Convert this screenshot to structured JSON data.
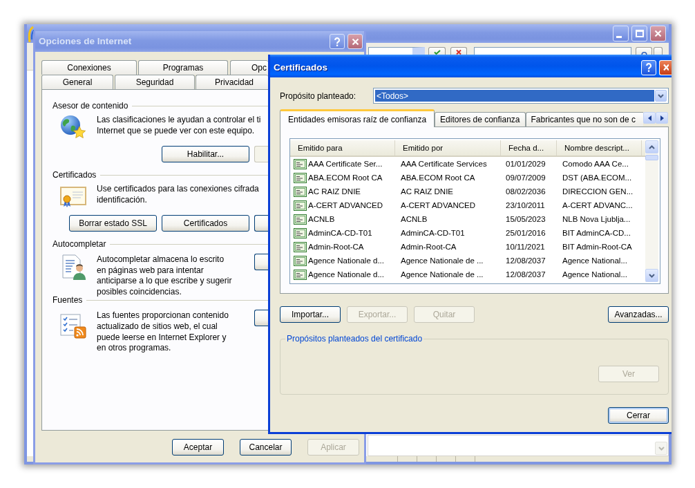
{
  "browser_window": {
    "active": false
  },
  "internet_options": {
    "title": "Opciones de Internet",
    "active": false,
    "tab_rows": [
      {
        "tabs": [
          {
            "label": "Conexiones",
            "selected": false
          },
          {
            "label": "Programas",
            "selected": false
          },
          {
            "label": "Opc",
            "selected": false
          }
        ]
      },
      {
        "tabs": [
          {
            "label": "General",
            "selected": false
          },
          {
            "label": "Seguridad",
            "selected": false
          },
          {
            "label": "Privacidad",
            "selected": false
          }
        ]
      }
    ],
    "groups": [
      {
        "kind": "ratings",
        "heading": "Asesor de contenido",
        "text": "Las clasificaciones le ayudan a controlar el ti\nInternet que se puede ver con este equipo.",
        "buttons": [
          {
            "label": "Habilitar...",
            "disabled": false
          },
          {
            "disabled": true
          }
        ]
      },
      {
        "kind": "certificates",
        "heading": "Certificados",
        "text": "Use certificados para las conexiones cifrada\nidentificación.",
        "buttons": [
          {
            "label": "Borrar estado SSL",
            "disabled": false
          },
          {
            "label": "Certificados",
            "disabled": false
          },
          {
            "disabled": false
          }
        ]
      },
      {
        "kind": "autocomplete",
        "heading": "Autocompletar",
        "text": "Autocompletar almacena lo escrito\nen páginas web para intentar\nanticiparse a lo que escribe y sugerir\nposibles coincidencias.",
        "buttons": [
          {
            "disabled": false
          }
        ]
      },
      {
        "kind": "feeds",
        "heading": "Fuentes",
        "text": "Las fuentes proporcionan contenido\nactualizado de sitios web, el cual\npuede leerse en Internet Explorer y\nen otros programas.",
        "buttons": [
          {
            "disabled": false
          }
        ]
      }
    ],
    "buttons": [
      {
        "label": "Aceptar",
        "disabled": false
      },
      {
        "label": "Cancelar",
        "disabled": false
      },
      {
        "label": "Aplicar",
        "disabled": true
      }
    ]
  },
  "certificates_dialog": {
    "title": "Certificados",
    "active": true,
    "purpose": {
      "label": "Propósito planteado:",
      "value": "<Todos>",
      "focused": true
    },
    "tabs": [
      {
        "label": "Entidades emisoras raíz de confianza",
        "selected": true
      },
      {
        "label": "Editores de confianza",
        "selected": false
      },
      {
        "label": "Fabricantes que no son de c",
        "selected": false
      }
    ],
    "table": {
      "columns": [
        "Emitido para",
        "Emitido por",
        "Fecha d...",
        "Nombre descript..."
      ],
      "rows": [
        [
          "AAA Certificate Ser...",
          "AAA Certificate Services",
          "01/01/2029",
          "Comodo AAA Ce..."
        ],
        [
          "ABA.ECOM Root CA",
          "ABA.ECOM Root CA",
          "09/07/2009",
          "DST (ABA.ECOM..."
        ],
        [
          "AC RAIZ DNIE",
          "AC RAIZ DNIE",
          "08/02/2036",
          "DIRECCION GEN..."
        ],
        [
          "A-CERT ADVANCED",
          "A-CERT ADVANCED",
          "23/10/2011",
          "A-CERT ADVANC..."
        ],
        [
          "ACNLB",
          "ACNLB",
          "15/05/2023",
          "NLB Nova Ljublja..."
        ],
        [
          "AdminCA-CD-T01",
          "AdminCA-CD-T01",
          "25/01/2016",
          "BIT AdminCA-CD..."
        ],
        [
          "Admin-Root-CA",
          "Admin-Root-CA",
          "10/11/2021",
          "BIT Admin-Root-CA"
        ],
        [
          "Agence Nationale d...",
          "Agence Nationale de ...",
          "12/08/2037",
          "Agence National..."
        ],
        [
          "Agence Nationale d...",
          "Agence Nationale de ...",
          "12/08/2037",
          "Agence National..."
        ]
      ]
    },
    "buttons": [
      {
        "label": "Importar...",
        "disabled": false
      },
      {
        "label": "Exportar...",
        "disabled": true
      },
      {
        "label": "Quitar",
        "disabled": true
      },
      {
        "label": "Avanzadas...",
        "disabled": false
      }
    ],
    "purposes_group": {
      "heading": "Propósitos planteados del certificado",
      "view_button": {
        "label": "Ver",
        "disabled": true
      }
    },
    "close_button": {
      "label": "Cerrar",
      "default": true
    }
  }
}
